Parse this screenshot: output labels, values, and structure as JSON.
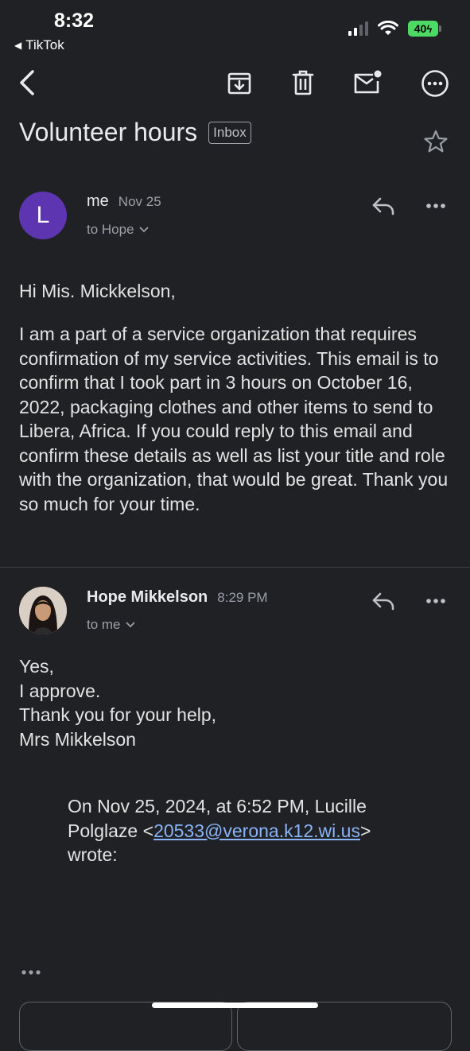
{
  "status_bar": {
    "time": "8:32",
    "back_app": "TikTok",
    "battery": "40"
  },
  "toolbar": {
    "back_icon": "back-arrow-icon",
    "archive_icon": "archive-icon",
    "delete_icon": "trash-icon",
    "unread_icon": "mark-unread-icon",
    "more_icon": "more-circle-icon"
  },
  "email": {
    "subject": "Volunteer hours",
    "label": "Inbox"
  },
  "messages": [
    {
      "avatar_letter": "L",
      "sender": "me",
      "date": "Nov 25",
      "to": "to Hope",
      "greeting": "Hi Mis. Mickkelson,",
      "body": "I am a part of a service organization that requires confirmation of my service activities. This email is to confirm that I took part in 3 hours on October 16, 2022, packaging clothes and other items to send to Libera, Africa. If you could reply to this email and confirm these details as well as list your title and role with the organization, that would be great. Thank you so much for your time."
    },
    {
      "sender": "Hope Mikkelson",
      "date": "8:29 PM",
      "to": "to me",
      "lines": [
        "Yes,",
        "I approve.",
        "Thank you for your help,",
        "Mrs Mikkelson"
      ],
      "quote_prefix": "On Nov 25, 2024, at 6:52 PM, Lucille Polglaze <",
      "quote_email": "20533@verona.k12.wi.us",
      "quote_suffix": ">",
      "quote_wrote": "wrote:"
    }
  ],
  "colors": {
    "background": "#202124",
    "avatar_purple": "#5e35b1",
    "link": "#8ab4f8",
    "battery_green": "#4cd964"
  }
}
